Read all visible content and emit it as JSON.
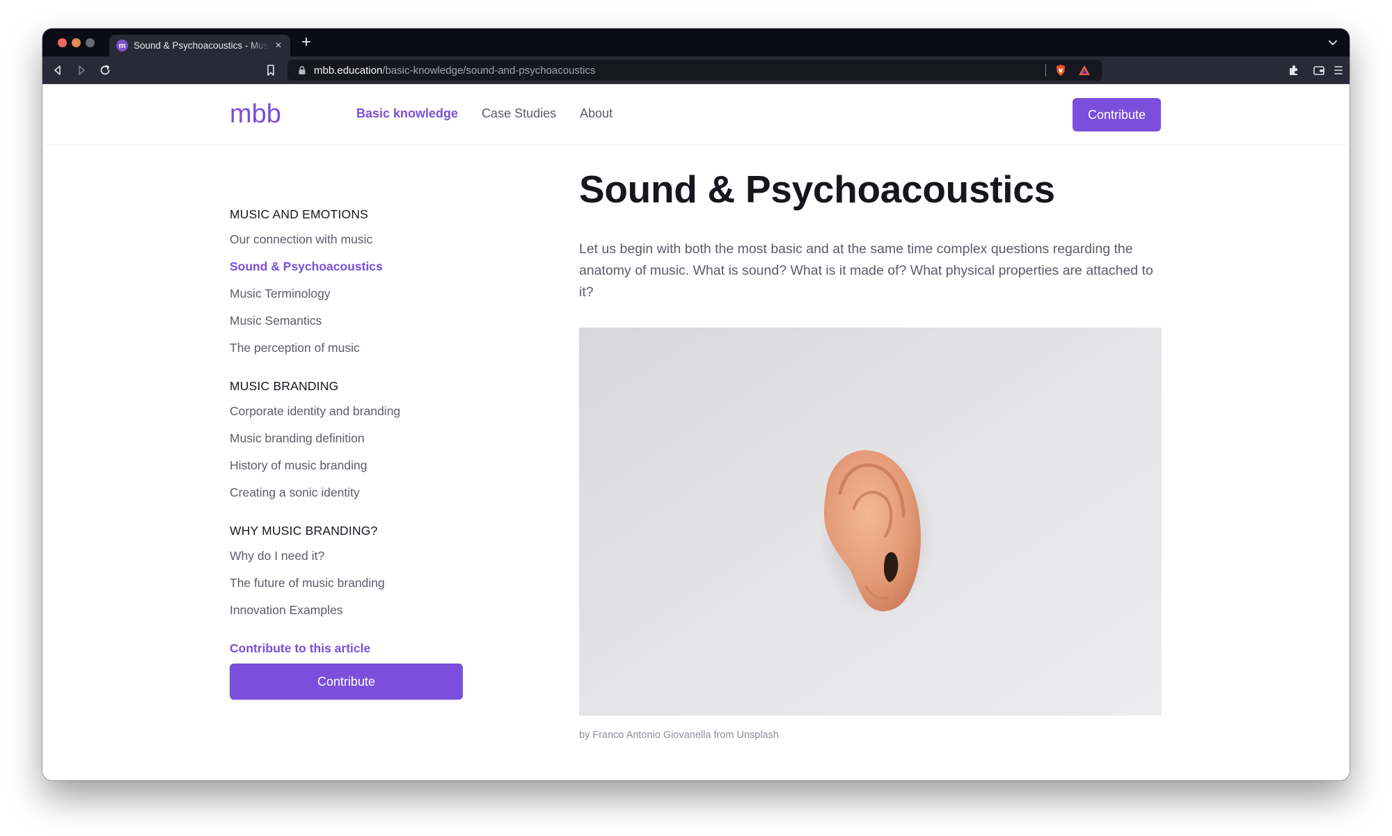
{
  "browser": {
    "tab_title": "Sound & Psychoacoustics - Music Branding Book",
    "tab_favicon": "m",
    "url_host": "mbb.education",
    "url_path": "/basic-knowledge/sound-and-psychoacoustics",
    "accent": "#7b4fdb"
  },
  "header": {
    "logo_text": "mbb",
    "nav": [
      {
        "label": "Basic knowledge",
        "active": true
      },
      {
        "label": "Case Studies",
        "active": false
      },
      {
        "label": "About",
        "active": false
      }
    ],
    "contribute_label": "Contribute"
  },
  "sidebar": {
    "sections": [
      {
        "heading": "MUSIC AND EMOTIONS",
        "items": [
          {
            "label": "Our connection with music"
          },
          {
            "label": "Sound & Psychoacoustics",
            "active": true
          },
          {
            "label": "Music Terminology"
          },
          {
            "label": "Music Semantics"
          },
          {
            "label": "The perception of music"
          }
        ]
      },
      {
        "heading": "MUSIC BRANDING",
        "items": [
          {
            "label": "Corporate identity and branding"
          },
          {
            "label": "Music branding definition"
          },
          {
            "label": "History of music branding"
          },
          {
            "label": "Creating a sonic identity"
          }
        ]
      },
      {
        "heading": "WHY MUSIC BRANDING?",
        "items": [
          {
            "label": "Why do I need it?"
          },
          {
            "label": "The future of music branding"
          },
          {
            "label": "Innovation Examples"
          }
        ]
      }
    ],
    "contribute_link": "Contribute to this article",
    "contribute_button": "Contribute"
  },
  "article": {
    "title": "Sound & Psychoacoustics",
    "intro": "Let us begin with both the most basic and at the same time complex questions regarding the anatomy of music. What is sound? What is it made of? What physical properties are attached to it?",
    "image_caption": "by Franco Antonio Giovanella from Unsplash"
  }
}
